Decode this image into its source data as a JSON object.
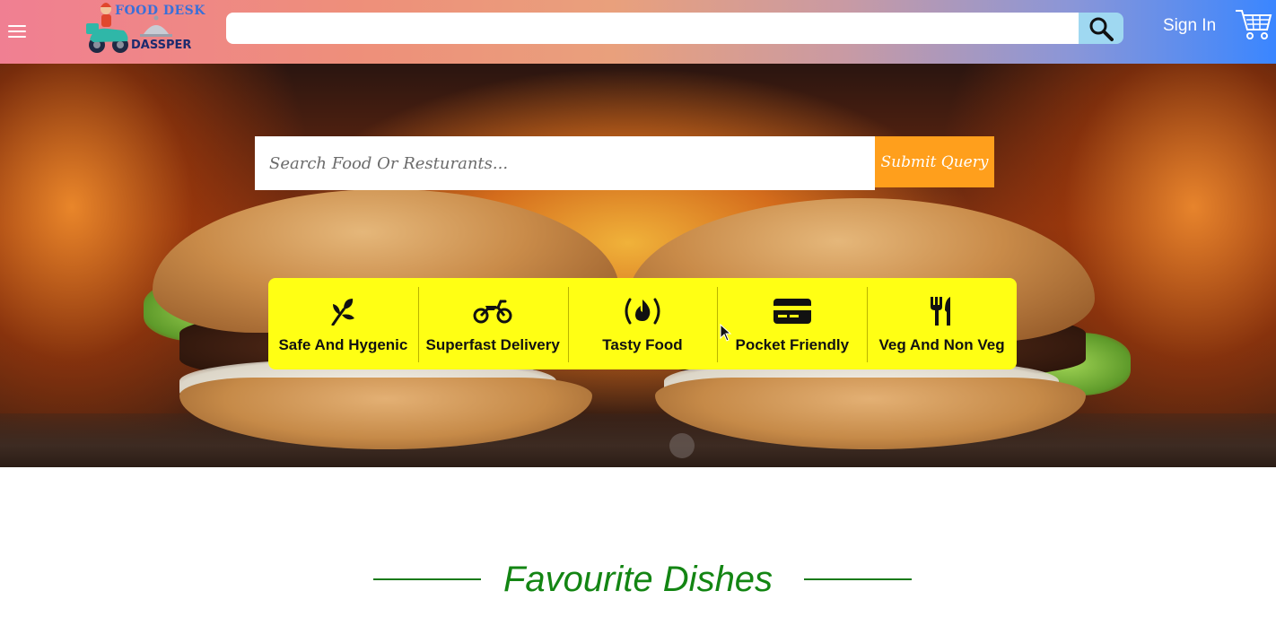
{
  "header": {
    "logo": {
      "line1": "FOOD DESK",
      "line2": "DASSPER"
    },
    "menu_icon": "hamburger-icon",
    "search": {
      "placeholder": "",
      "value": ""
    },
    "search_icon": "search-icon",
    "signin_label": "Sign In",
    "cart_icon": "cart-icon"
  },
  "hero": {
    "search": {
      "placeholder": "Search Food Or Resturants...",
      "value": ""
    },
    "submit_label": "Submit Query",
    "features": [
      {
        "icon": "seedling-icon",
        "label": "Safe And Hygenic"
      },
      {
        "icon": "motorcycle-icon",
        "label": "Superfast Delivery"
      },
      {
        "icon": "fire-icon",
        "label": "Tasty Food"
      },
      {
        "icon": "credit-card-icon",
        "label": "Pocket Friendly"
      },
      {
        "icon": "utensils-icon",
        "label": "Veg And Non Veg"
      }
    ]
  },
  "section": {
    "title": "Favourite Dishes"
  },
  "colors": {
    "feature_bg": "#ffff14",
    "submit_bg": "#ff9f1c",
    "title_green": "#138513",
    "search_btn": "#9fd8f1"
  }
}
